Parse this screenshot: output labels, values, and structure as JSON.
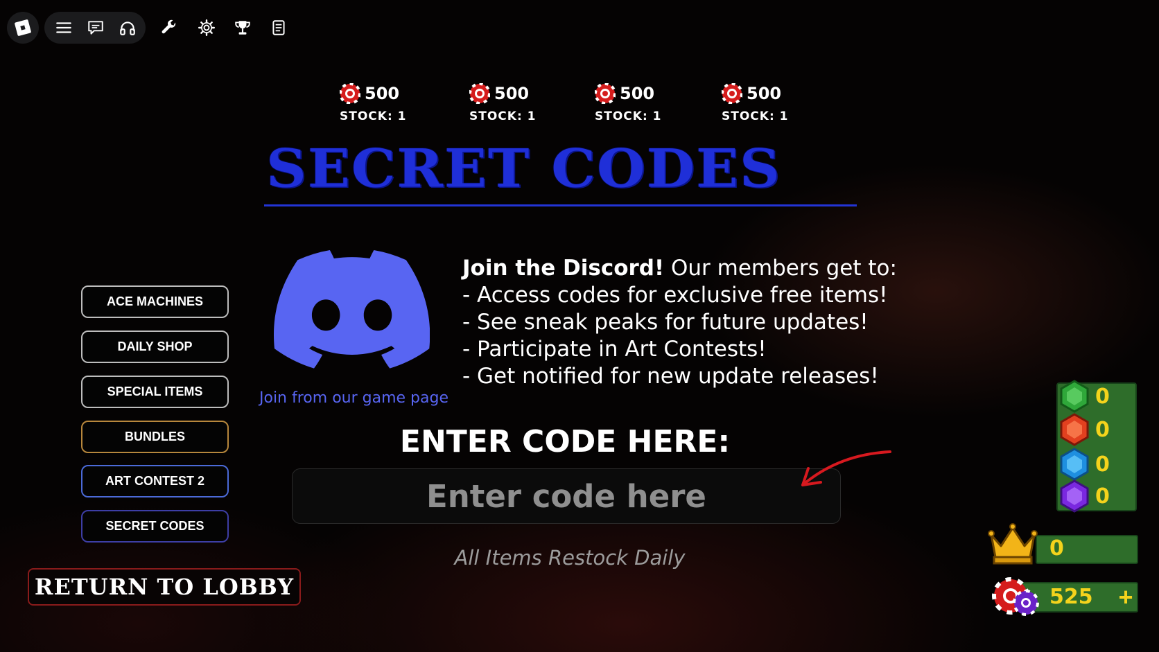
{
  "topbar": {
    "icons": [
      "roblox-logo-icon",
      "menu-icon",
      "chat-icon",
      "headphones-icon",
      "wrench-icon",
      "gear-icon",
      "trophy-icon",
      "scroll-icon"
    ]
  },
  "rewards": [
    {
      "amount": "500",
      "stock": "STOCK: 1"
    },
    {
      "amount": "500",
      "stock": "STOCK: 1"
    },
    {
      "amount": "500",
      "stock": "STOCK: 1"
    },
    {
      "amount": "500",
      "stock": "STOCK: 1"
    }
  ],
  "title": "SECRET CODES",
  "discord": {
    "link_text": "Join from our game page",
    "headline_bold": "Join the Discord!",
    "headline_rest": " Our members get to:",
    "perks": [
      "- Access codes for exclusive free items!",
      "- See sneak peaks for future updates!",
      "- Participate in Art Contests!",
      "- Get notified for new update releases!"
    ]
  },
  "menu": {
    "items": [
      "ACE MACHINES",
      "DAILY SHOP",
      "SPECIAL ITEMS",
      "BUNDLES",
      "ART CONTEST 2",
      "SECRET CODES"
    ],
    "return_label": "RETURN TO LOBBY"
  },
  "code_entry": {
    "label": "ENTER CODE HERE:",
    "placeholder": "Enter code here",
    "value": "",
    "footer": "All Items Restock Daily"
  },
  "currencies": {
    "gems": [
      {
        "name": "green-gem-icon",
        "color": "#2fa83a",
        "count": "0"
      },
      {
        "name": "red-gem-icon",
        "color": "#e2401f",
        "count": "0"
      },
      {
        "name": "blue-gem-icon",
        "color": "#1e8fe0",
        "count": "0"
      },
      {
        "name": "purple-gem-icon",
        "color": "#7a28e0",
        "count": "0"
      }
    ],
    "crowns": "0",
    "chips": "525",
    "add_label": "+"
  },
  "colors": {
    "title_blue": "#1f2fd8",
    "discord_blurple": "#5865f2",
    "currency_yellow": "#f4d31c",
    "panel_green": "#2e6d2a"
  }
}
